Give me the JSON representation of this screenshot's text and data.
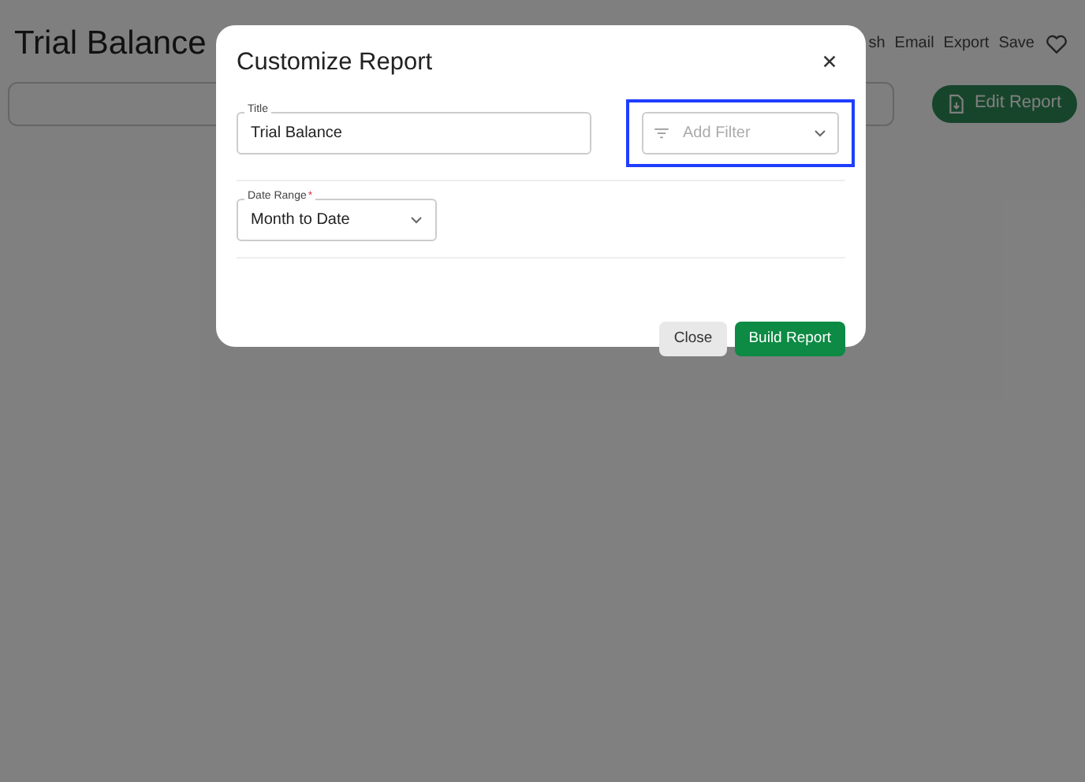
{
  "page": {
    "title": "Trial Balance",
    "actions": [
      "sh",
      "Email",
      "Export",
      "Save"
    ],
    "edit_button": "Edit Report"
  },
  "dialog": {
    "title": "Customize Report",
    "title_field": {
      "label": "Title",
      "value": "Trial Balance"
    },
    "filter_field": {
      "placeholder": "Add Filter",
      "highlighted": true
    },
    "date_range": {
      "label": "Date Range",
      "required_mark": "*",
      "value": "Month to Date"
    },
    "buttons": [
      {
        "label": "Close",
        "kind": "secondary"
      },
      {
        "label": "Build Report",
        "kind": "primary"
      }
    ]
  }
}
